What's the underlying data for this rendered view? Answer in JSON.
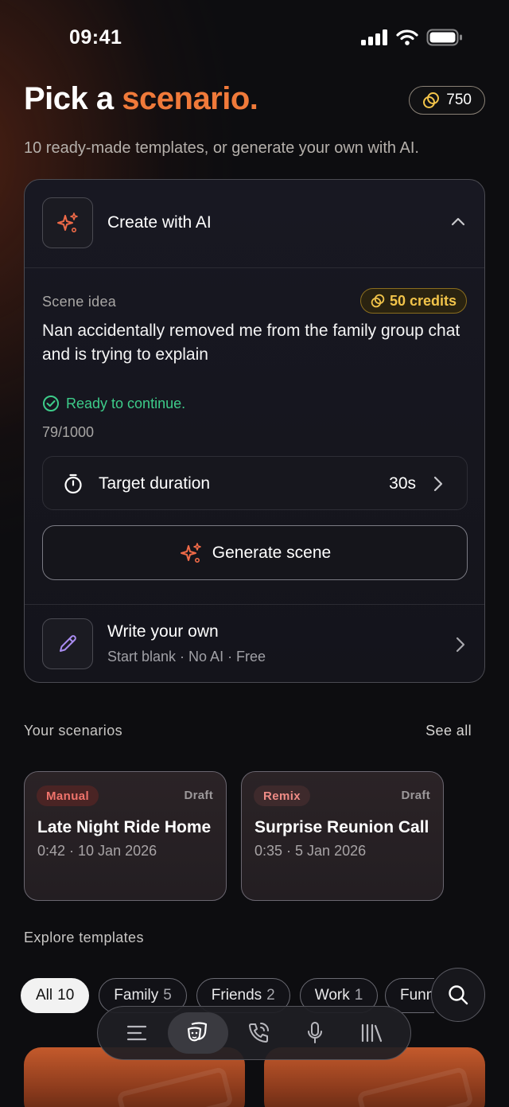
{
  "status": {
    "time": "09:41"
  },
  "header": {
    "title_prefix": "Pick a ",
    "title_accent": "scenario.",
    "credits": "750",
    "subtitle": "10 ready-made templates, or generate your own with AI."
  },
  "create_ai": {
    "label": "Create with AI",
    "scene_label": "Scene idea",
    "cost": "50 credits",
    "scene_text": "Nan accidentally removed me from the family group chat and is trying to explain",
    "ready": "Ready to continue.",
    "counter": "79/1000",
    "duration_label": "Target duration",
    "duration_value": "30s",
    "generate_label": "Generate scene"
  },
  "write_own": {
    "title": "Write your own",
    "subtitle": "Start blank · No AI · Free"
  },
  "your_scenarios": {
    "title": "Your scenarios",
    "see_all": "See all",
    "items": [
      {
        "tag": "Manual",
        "status": "Draft",
        "name": "Late Night Ride Home",
        "meta": "0:42 · 10 Jan 2026"
      },
      {
        "tag": "Remix",
        "status": "Draft",
        "name": "Surprise Reunion Call",
        "meta": "0:35 · 5 Jan 2026"
      }
    ]
  },
  "explore": {
    "title": "Explore templates",
    "chips": [
      {
        "label": "All",
        "count": "10"
      },
      {
        "label": "Family",
        "count": "5"
      },
      {
        "label": "Friends",
        "count": "2"
      },
      {
        "label": "Work",
        "count": "1"
      },
      {
        "label": "Funny",
        "count": ""
      }
    ]
  },
  "colors": {
    "accent": "#f07a3a",
    "success": "#3dcc8a",
    "credit": "#f2c44a"
  },
  "tabbar": {
    "icons": [
      "menu-icon",
      "theater-masks-icon",
      "phone-call-icon",
      "microphone-icon",
      "library-icon"
    ]
  }
}
